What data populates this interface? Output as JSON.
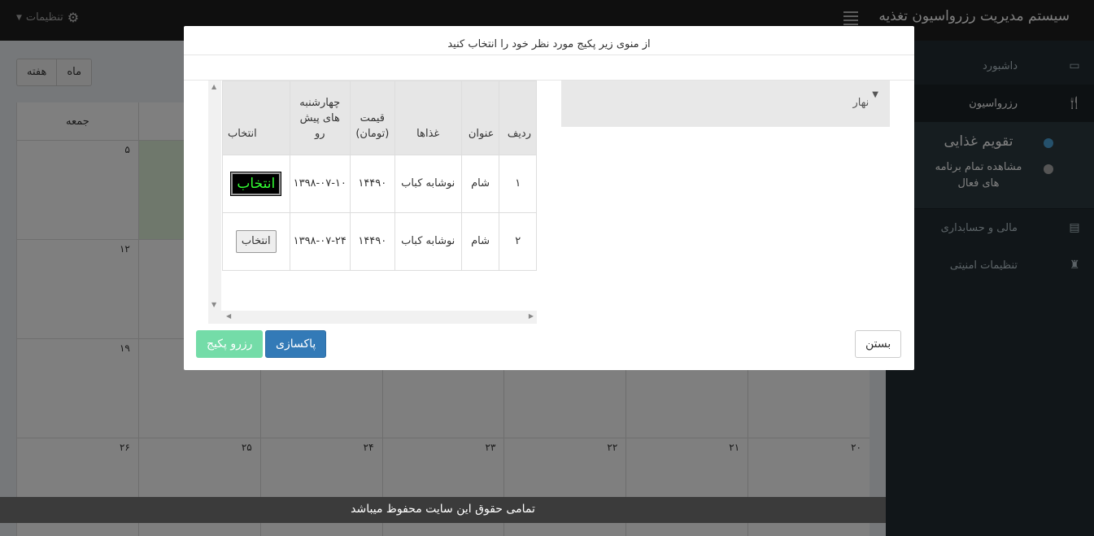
{
  "app": {
    "title": "سیستم مدیریت رزرواسیون تغذیه",
    "settings_label": "تنظیمات"
  },
  "sidebar": {
    "items": [
      {
        "label": "داشبورد"
      },
      {
        "label": "رزرواسیون"
      }
    ],
    "submenu": [
      {
        "label": "تقویم غذایی"
      },
      {
        "label": "مشاهده تمام برنامه های فعال"
      }
    ],
    "items2": [
      {
        "label": "مالی و حسابداری"
      },
      {
        "label": "تنظیمات امنیتی"
      }
    ]
  },
  "calendar": {
    "view_buttons": [
      "ماه",
      "هفته"
    ],
    "header_days": [
      "",
      "",
      "",
      "",
      "",
      "",
      "جمعه"
    ],
    "rows": [
      [
        "",
        "",
        "",
        "",
        "",
        "",
        "۵"
      ],
      [
        "",
        "",
        "",
        "",
        "",
        "",
        "۱۲"
      ],
      [
        "",
        "",
        "",
        "",
        "",
        "",
        "۱۹"
      ],
      [
        "۲۰",
        "۲۱",
        "۲۲",
        "۲۳",
        "۲۴",
        "۲۵",
        "۲۶"
      ]
    ]
  },
  "modal": {
    "title": "از منوی زیر پکیج مورد نظر خود را انتخاب کنید",
    "accordion_label": "نهار",
    "table": {
      "headers": [
        "ردیف",
        "عنوان",
        "غذاها",
        "قیمت (تومان)",
        "چهارشنبه های پیش رو",
        "انتخاب"
      ],
      "rows": [
        {
          "rad": "۱",
          "onvan": "شام",
          "ghaza": "نوشابه کباب",
          "price": "۱۴۴۹۰",
          "date": "۱۳۹۸-۰۷-۱۰",
          "select": "انتخاب"
        },
        {
          "rad": "۲",
          "onvan": "شام",
          "ghaza": "نوشابه کباب",
          "price": "۱۴۴۹۰",
          "date": "۱۳۹۸-۰۷-۲۴",
          "select": "انتخاب"
        }
      ]
    },
    "buttons": {
      "close": "بستن",
      "clear": "پاکسازی",
      "reserve": "رزرو پکیج"
    }
  },
  "footer": {
    "text": "تمامی حقوق این سایت محفوظ میباشد"
  }
}
